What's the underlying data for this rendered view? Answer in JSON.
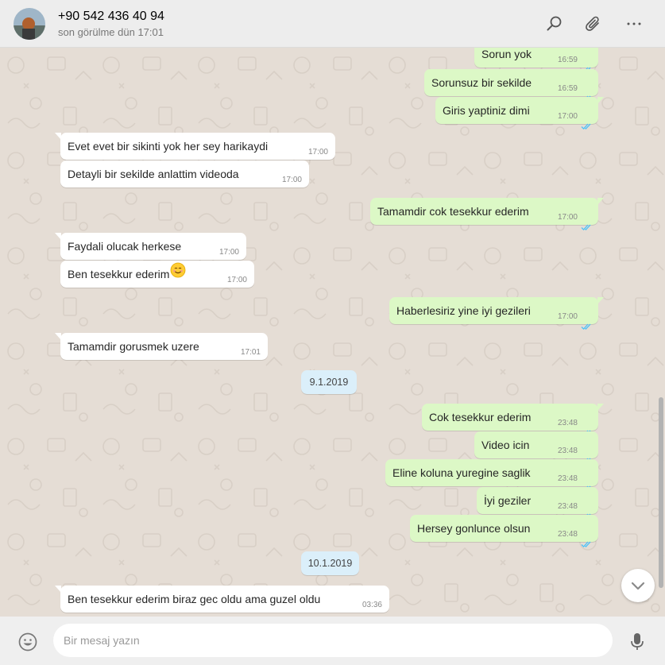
{
  "header": {
    "contact_name": "+90 542 436 40 94",
    "status": "son görülme dün 17:01",
    "icons": [
      "search-icon",
      "attach-icon",
      "menu-icon"
    ]
  },
  "messages": [
    {
      "dir": "out",
      "text": "Sorun yok",
      "time": "16:59"
    },
    {
      "dir": "out",
      "text": "Sorunsuz bir sekilde",
      "time": "16:59"
    },
    {
      "dir": "out",
      "text": "Giris yaptiniz dimi",
      "time": "17:00"
    },
    {
      "dir": "in",
      "text": "Evet evet bir sikinti yok her sey harikaydi",
      "time": "17:00"
    },
    {
      "dir": "in",
      "text": "Detayli bir sekilde anlattim videoda",
      "time": "17:00"
    },
    {
      "dir": "out",
      "text": "Tamamdir cok tesekkur ederim",
      "time": "17:00"
    },
    {
      "dir": "in",
      "text": "Faydali olucak herkese",
      "time": "17:00"
    },
    {
      "dir": "in",
      "text": "Ben tesekkur ederim",
      "time": "17:00",
      "emoji": "smiling-face-emoji"
    },
    {
      "dir": "out",
      "text": "Haberlesiriz yine iyi gezileri",
      "time": "17:00"
    },
    {
      "dir": "in",
      "text": "Tamamdir gorusmek uzere",
      "time": "17:01"
    },
    {
      "dir": "out",
      "text": "Cok tesekkur ederim",
      "time": "23:48"
    },
    {
      "dir": "out",
      "text": "Video icin",
      "time": "23:48"
    },
    {
      "dir": "out",
      "text": "Eline koluna yuregine saglik",
      "time": "23:48"
    },
    {
      "dir": "out",
      "text": "İyi geziler",
      "time": "23:48"
    },
    {
      "dir": "out",
      "text": "Hersey gonlunce olsun",
      "time": "23:48"
    },
    {
      "dir": "in",
      "text": "Ben tesekkur ederim biraz gec oldu ama guzel oldu",
      "time": "03:36"
    }
  ],
  "dates": [
    "9.1.2019",
    "10.1.2019"
  ],
  "composer": {
    "placeholder": "Bir mesaj yazın",
    "icons": [
      "emoji-icon",
      "microphone-icon"
    ]
  },
  "colors": {
    "chat_background": "#e5ddd5",
    "outgoing_bubble": "#dcf8c6",
    "incoming_bubble": "#ffffff",
    "date_chip": "#dbeffa",
    "read_ticks": "#4fc3f7"
  }
}
